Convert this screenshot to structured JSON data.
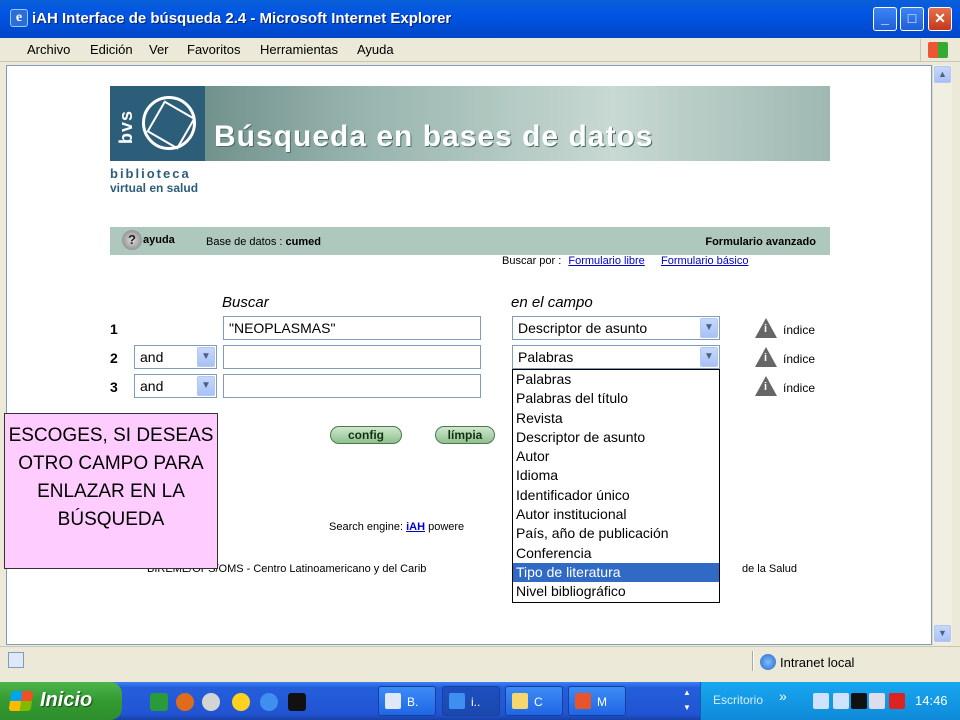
{
  "window": {
    "title": "iAH Interface de búsqueda 2.4 - Microsoft Internet Explorer",
    "minimize": "_",
    "maximize": "□",
    "close": "✕"
  },
  "menu": [
    "Archivo",
    "Edición",
    "Ver",
    "Favoritos",
    "Herramientas",
    "Ayuda"
  ],
  "banner": {
    "logo_text": "bvs",
    "title": "Búsqueda en bases de datos",
    "subtitle1": "biblioteca",
    "subtitle2": "virtual en salud"
  },
  "infobar": {
    "help": "ayuda",
    "db_label": "Base de datos :",
    "db_name": "cumed",
    "form_type": "Formulario avanzado"
  },
  "search_by": {
    "label": "Buscar por :",
    "link1": "Formulario libre",
    "link2": "Formulario básico"
  },
  "form": {
    "col_search": "Buscar",
    "col_field": "en el campo",
    "rows": [
      {
        "num": "1",
        "operator": "",
        "term": "\"NEOPLASMAS\"",
        "field": "Descriptor de asunto",
        "index": "índice"
      },
      {
        "num": "2",
        "operator": "and",
        "term": "",
        "field": "Palabras",
        "index": "índice"
      },
      {
        "num": "3",
        "operator": "and",
        "term": "",
        "field": "",
        "index": "índice"
      }
    ],
    "btn_config": "config",
    "btn_clear": "límpia"
  },
  "dropdown_options": [
    "Palabras",
    "Palabras del título",
    "Revista",
    "Descriptor de asunto",
    "Autor",
    "Idioma",
    "Identificador único",
    "Autor institucional",
    "País, año de publicación",
    "Conferencia",
    "Tipo de literatura",
    "Nivel bibliográfico"
  ],
  "dropdown_highlighted": "Tipo de literatura",
  "engine": {
    "prefix": "Search engine:",
    "link": "iAH",
    "suffix": "powere"
  },
  "footer": {
    "left": "BIREME/OPS/OMS - Centro Latinoamericano y del Carib",
    "right": "de la Salud"
  },
  "callout": "ESCOGES, SI DESEAS OTRO CAMPO PARA ENLAZAR EN LA BÚSQUEDA",
  "status": {
    "zone": "Intranet local"
  },
  "taskbar": {
    "start": "Inicio",
    "tasks": [
      "B.",
      "i..",
      "C",
      "M"
    ],
    "desktop": "Escritorio",
    "clock": "14:46"
  },
  "colors": {
    "highlight": "#316ac5",
    "callout_bg": "#ffccff",
    "infobar_bg": "#aec8bd"
  }
}
